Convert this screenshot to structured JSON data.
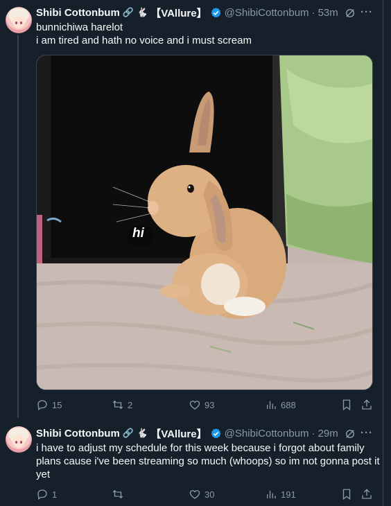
{
  "tweets": [
    {
      "display_name": "Shibi Cottonbum",
      "name_emoji_1": "🔗",
      "name_emoji_2": "🐇",
      "name_tag": "【VAllure】",
      "handle": "@ShibiCottonbum",
      "separator": "·",
      "time": "53m",
      "text_line_1": "bunnichiwa harelot",
      "text_line_2": "i am tired and hath no voice and i must scream",
      "media_caption": "hi",
      "replies": "15",
      "retweets": "2",
      "likes": "93",
      "views": "688"
    },
    {
      "display_name": "Shibi Cottonbum",
      "name_emoji_1": "🔗",
      "name_emoji_2": "🐇",
      "name_tag": "【VAllure】",
      "handle": "@ShibiCottonbum",
      "separator": "·",
      "time": "29m",
      "text_line_1": "i have to adjust my schedule for this week because i forgot about family",
      "text_line_2": "plans cause i've been streaming so much (whoops) so im not gonna post it",
      "text_line_3": "yet",
      "replies": "1",
      "retweets": "",
      "likes": "30",
      "views": "191"
    }
  ],
  "more_label": "···",
  "colors": {
    "background": "#15202b",
    "text": "#f7f9f9",
    "muted": "#8b98a5",
    "verified": "#1d9bf0",
    "divider": "#38444d"
  },
  "icons": [
    "grok-icon",
    "more-icon",
    "reply-icon",
    "retweet-icon",
    "like-icon",
    "views-icon",
    "bookmark-icon",
    "share-icon",
    "verified-badge-icon"
  ]
}
